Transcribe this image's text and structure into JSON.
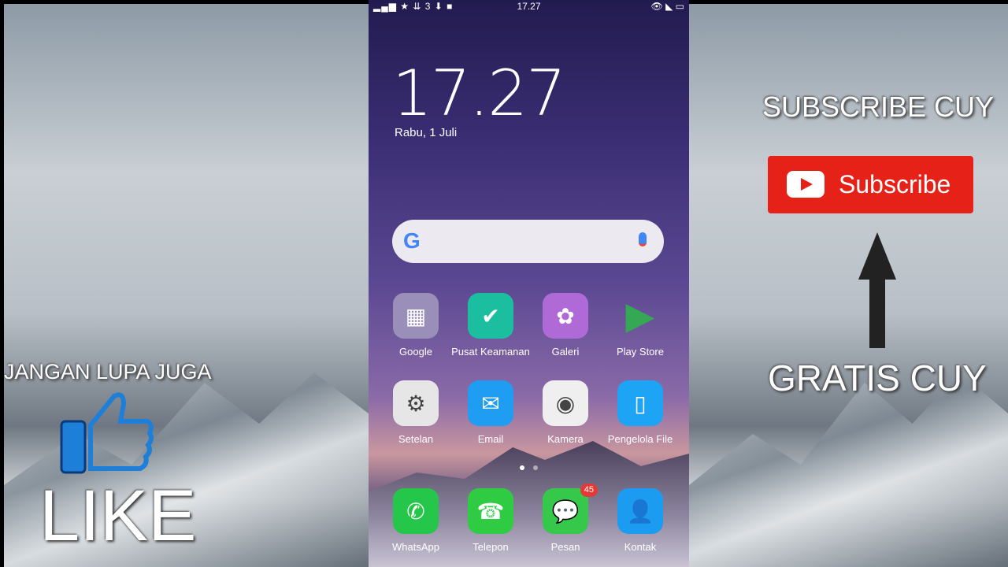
{
  "status_bar": {
    "left_icons": "signal wifi hotspot 3-carrier download video",
    "time": "17.27",
    "right_icons": "eye cast battery"
  },
  "lockclock": {
    "time": "17.27",
    "date": "Rabu, 1 Juli"
  },
  "search": {
    "logo": "G",
    "icon": "mic-icon"
  },
  "apps": [
    {
      "label": "Google",
      "icon": "folder-icon",
      "color": "#9a8fb8"
    },
    {
      "label": "Pusat Keamanan",
      "icon": "shield-icon",
      "color": "#1bbf9f"
    },
    {
      "label": "Galeri",
      "icon": "flower-icon",
      "color": "#b06ad8"
    },
    {
      "label": "Play Store",
      "icon": "play-store-icon",
      "color": "transparent"
    },
    {
      "label": "Setelan",
      "icon": "gear-icon",
      "color": "#e6e6e6"
    },
    {
      "label": "Email",
      "icon": "envelope-icon",
      "color": "#1e9df2"
    },
    {
      "label": "Kamera",
      "icon": "camera-icon",
      "color": "#efefef"
    },
    {
      "label": "Pengelola File",
      "icon": "file-icon",
      "color": "#1ea4f4"
    }
  ],
  "dock": [
    {
      "label": "WhatsApp",
      "icon": "whatsapp-icon",
      "color": "#25c74a"
    },
    {
      "label": "Telepon",
      "icon": "phone-icon",
      "color": "#2fcb43"
    },
    {
      "label": "Pesan",
      "icon": "message-icon",
      "color": "#35c84a",
      "badge": "45"
    },
    {
      "label": "Kontak",
      "icon": "contact-icon",
      "color": "#1c9cf0"
    }
  ],
  "page_indicator": {
    "pages": 2,
    "current": 1
  },
  "left_overlay": {
    "text1": "JANGAN LUPA JUGA",
    "text2": "LIKE"
  },
  "right_overlay": {
    "text1": "SUBSCRIBE CUY",
    "button": "Subscribe",
    "text2": "GRATIS CUY"
  }
}
